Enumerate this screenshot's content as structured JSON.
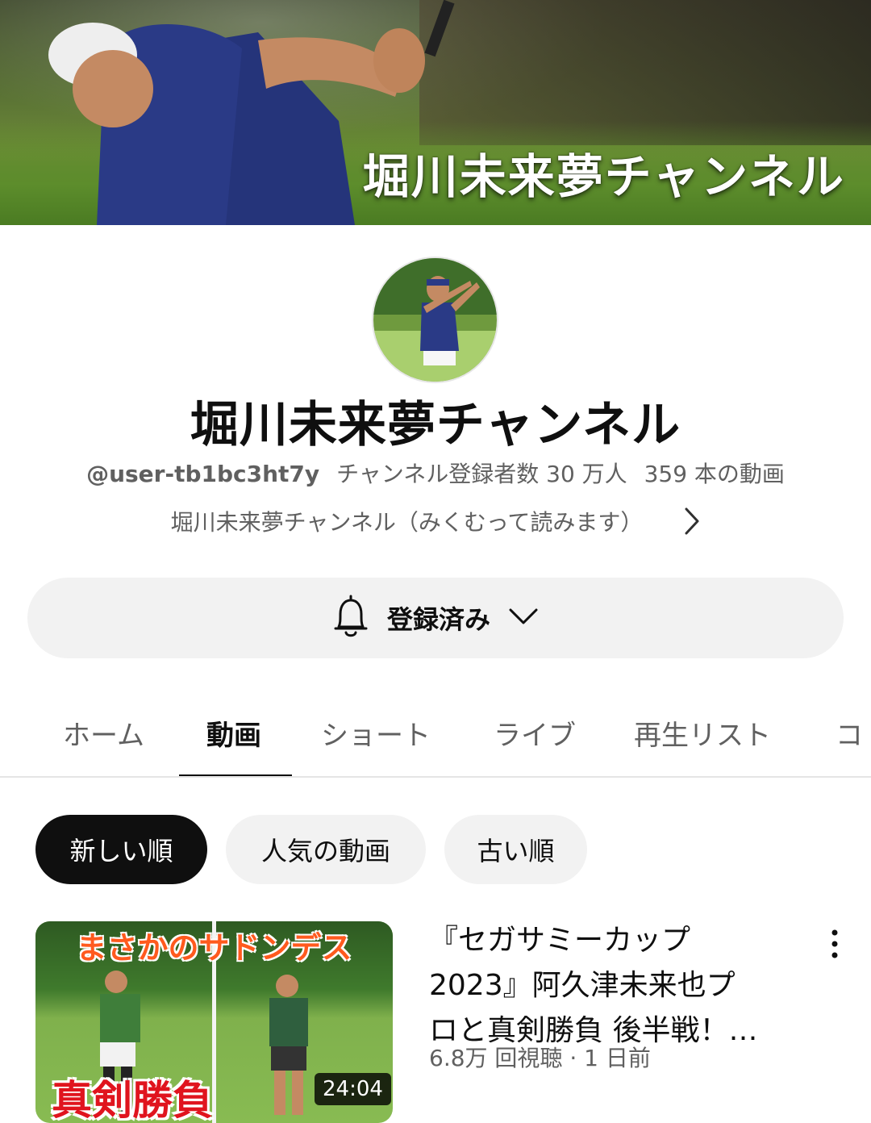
{
  "banner": {
    "title": "堀川未来夢チャンネル"
  },
  "channel": {
    "name": "堀川未来夢チャンネル",
    "handle": "@user-tb1bc3ht7y",
    "subscribers": "チャンネル登録者数 30 万人",
    "video_count": "359 本の動画",
    "description": "堀川未来夢チャンネル（みくむって読みます）"
  },
  "subscribe": {
    "label": "登録済み"
  },
  "tabs": [
    {
      "label": "ホーム"
    },
    {
      "label": "動画"
    },
    {
      "label": "ショート"
    },
    {
      "label": "ライブ"
    },
    {
      "label": "再生リスト"
    },
    {
      "label": "コ"
    }
  ],
  "active_tab": "動画",
  "chips": [
    {
      "label": "新しい順"
    },
    {
      "label": "人気の動画"
    },
    {
      "label": "古い順"
    }
  ],
  "video": {
    "thumb_top_text": "まさかのサドンデス",
    "thumb_bottom_text": "真剣勝負",
    "duration": "24:04",
    "title_lines": [
      "『セガサミーカップ",
      "2023』阿久津未来也プ",
      "ロと真剣勝負 後半戦！…"
    ],
    "meta": "6.8万 回視聴 · 1 日前"
  },
  "colors": {
    "text_primary": "#0f0f0f",
    "text_secondary": "#606060",
    "chip_bg": "#f2f2f2",
    "chip_active_bg": "#0f0f0f"
  },
  "icons": [
    "bell-icon",
    "chevron-down-icon",
    "chevron-right-icon",
    "more-vert-icon"
  ]
}
